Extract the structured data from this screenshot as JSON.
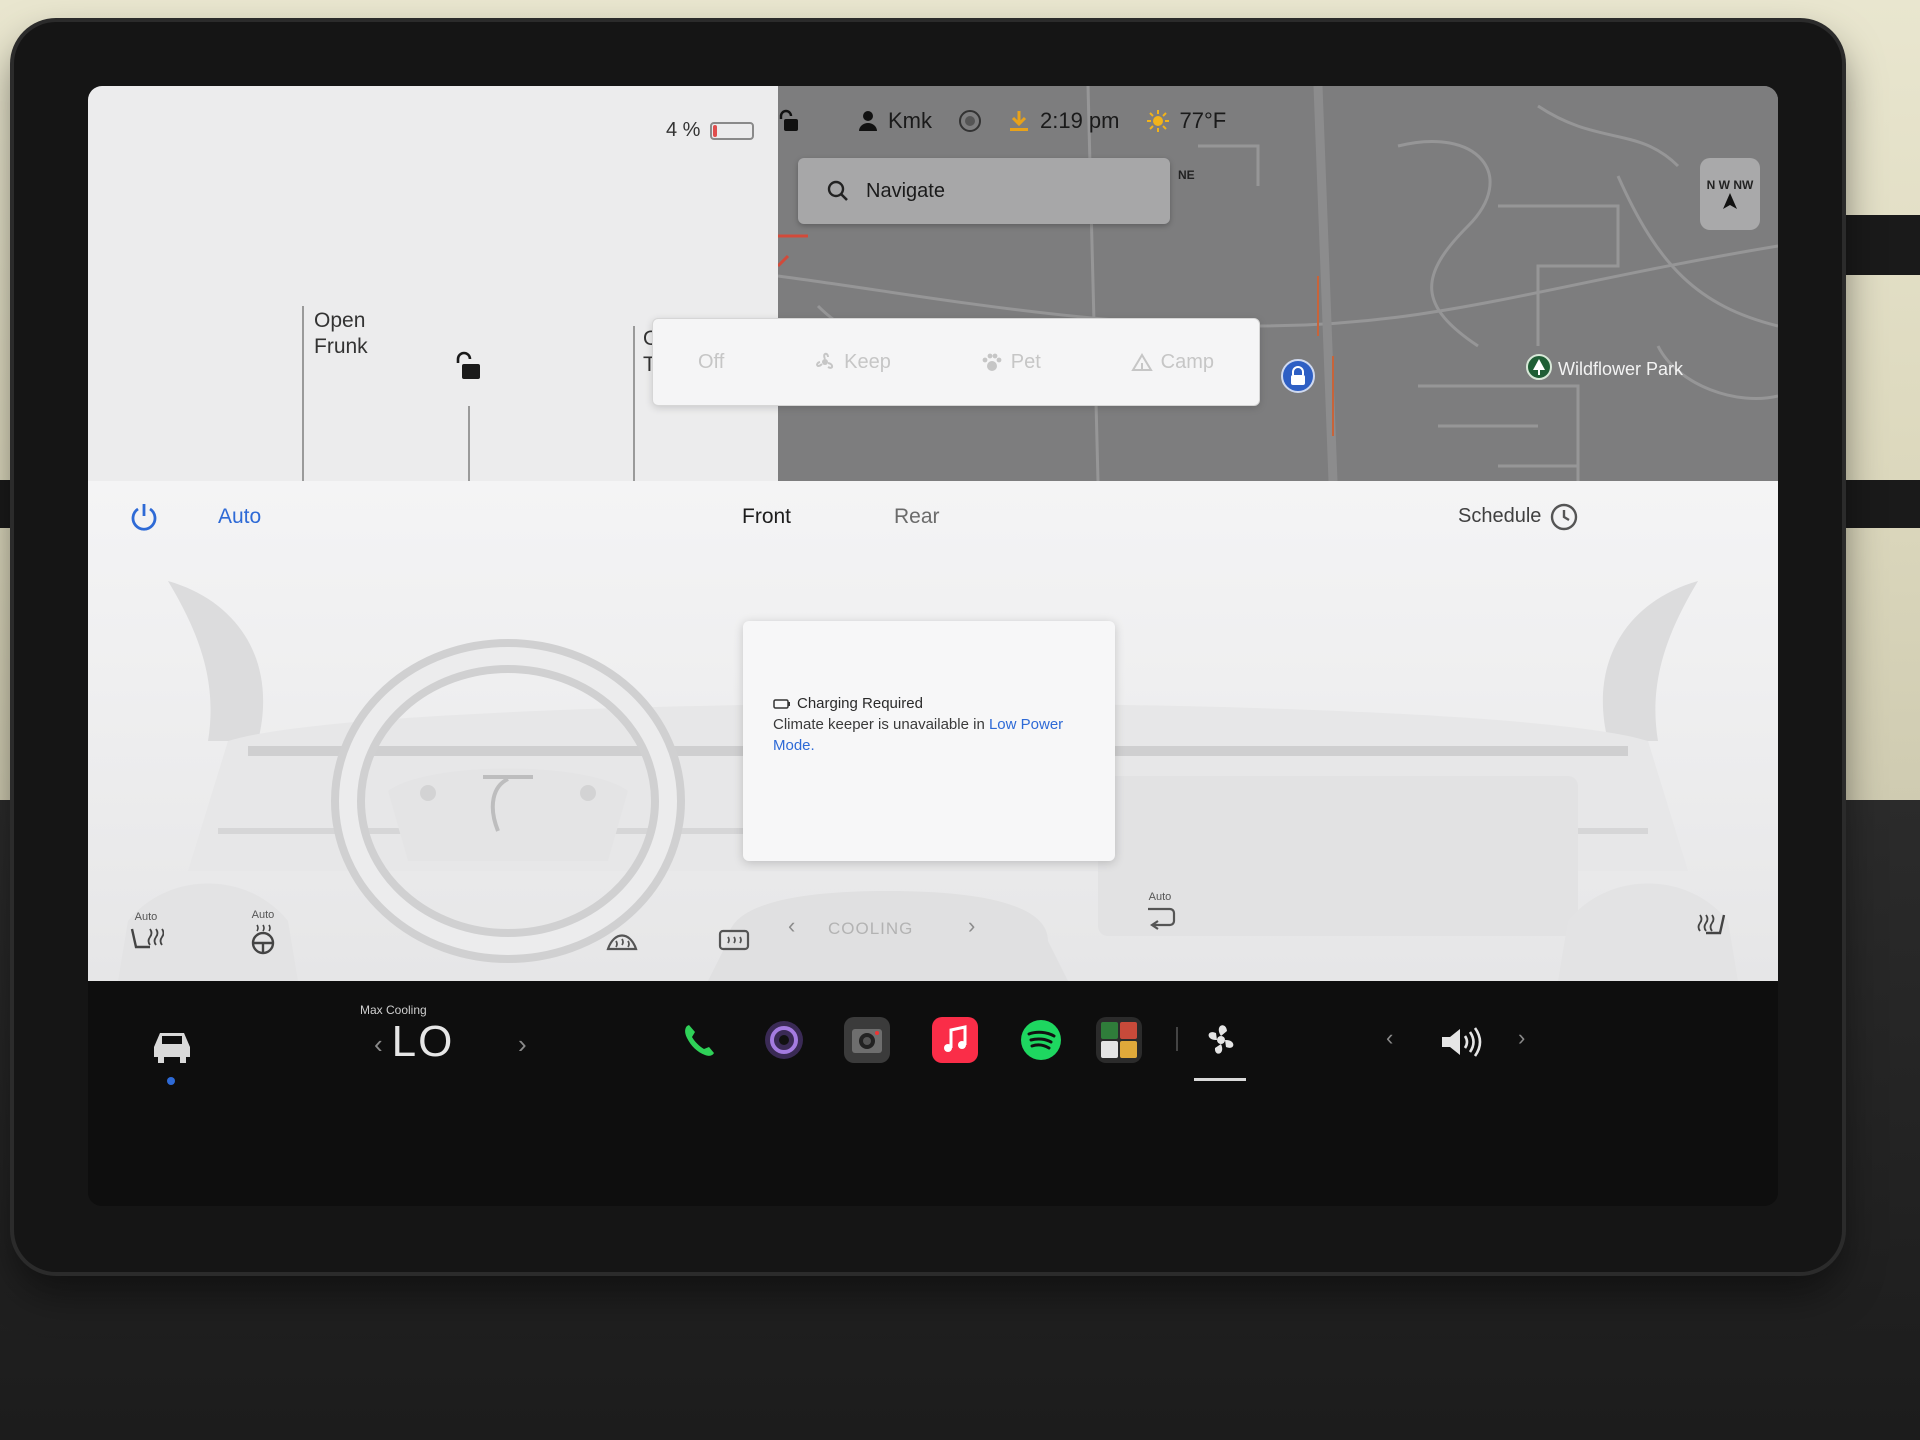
{
  "status": {
    "battery_percent": "4 %",
    "battery_level": 0.04,
    "profile_name": "Kmk",
    "time": "2:19 pm",
    "temperature": "77°F"
  },
  "car": {
    "frunk_open": "Open",
    "frunk_label": "Frunk",
    "trunk_open": "Open",
    "trunk_label": "Trunk"
  },
  "map": {
    "navigate_placeholder": "Navigate",
    "heading_label": "NE",
    "compass_letters": "N W NW",
    "poi_label": "Wildflower Park"
  },
  "climate_modes": {
    "off": "Off",
    "keep": "Keep",
    "pet": "Pet",
    "camp": "Camp"
  },
  "climate": {
    "auto_label": "Auto",
    "front_tab": "Front",
    "rear_tab": "Rear",
    "schedule_label": "Schedule",
    "notice_title": "Charging Required",
    "notice_body": "Climate keeper is unavailable in ",
    "notice_link": "Low Power Mode.",
    "cooling_label": "COOLING",
    "seat_left_auto": "Auto",
    "wheel_auto": "Auto",
    "recirc_auto": "Auto"
  },
  "dock": {
    "temp_mode": "Max Cooling",
    "temp_value": "LO",
    "apps": [
      "phone-icon",
      "camera-app-icon",
      "dashcam-icon",
      "music-icon",
      "spotify-icon",
      "toybox-icon",
      "fan-icon"
    ]
  },
  "colors": {
    "accent_blue": "#2e6ad6",
    "battery_red": "#e04e4e",
    "phone_green": "#2fd158",
    "music_red": "#fa2d48",
    "spotify_green": "#1ed760"
  }
}
